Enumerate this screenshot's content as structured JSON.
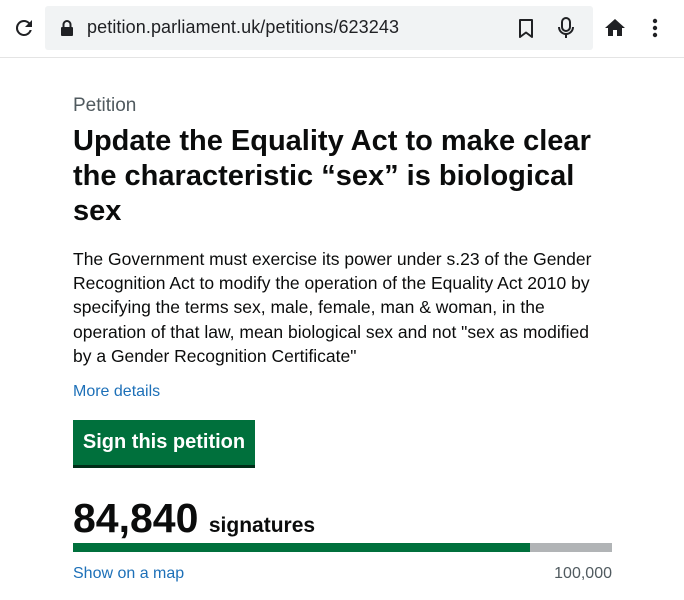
{
  "browser": {
    "url": "petition.parliament.uk/petitions/623243",
    "icons": [
      "reload-icon",
      "lock-icon",
      "bookmark-icon",
      "mic-icon",
      "home-icon",
      "more-vert-icon"
    ]
  },
  "petition": {
    "caption": "Petition",
    "title": "Update the Equality Act to make clear the characteristic “sex” is biological sex",
    "summary": "The Government must exercise its power under s.23 of the Gender Recognition Act to modify the operation of the Equality Act 2010 by specifying the terms sex, male, female, man & woman, in the operation of that law, mean biological sex and not \"sex as modified by a Gender Recognition Certificate\"",
    "more_details_label": "More details",
    "sign_button_label": "Sign this petition",
    "signature_count": "84,840",
    "signatures_label": "signatures",
    "progress_fraction": 0.8484,
    "show_on_map_label": "Show on a map",
    "target_label": "100,000"
  },
  "colors": {
    "primary_green": "#00703c",
    "link_blue": "#1d70b8",
    "progress_track": "#b1b4b6",
    "secondary_text": "#505a5f"
  }
}
